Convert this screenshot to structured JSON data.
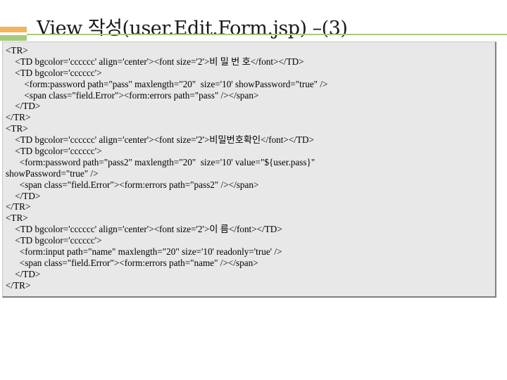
{
  "slide": {
    "title_prefix": "View ",
    "title_korean": "작성",
    "title_code": "(user.Edit.Form.jsp) –(3)"
  },
  "code_lines": [
    "<TR>",
    "    <TD bgcolor='cccccc' align='center'><font size='2'>비 밀 번 호</font></TD>",
    "    <TD bgcolor='cccccc'>",
    "        <form:password path=\"pass\" maxlength=\"20\"  size='10' showPassword=\"true\" />",
    "        <span class=\"field.Error\"><form:errors path=\"pass\" /></span>",
    "    </TD>",
    "</TR>",
    "<TR>",
    "    <TD bgcolor='cccccc' align='center'><font size='2'>비밀번호확인</font></TD>",
    "    <TD bgcolor='cccccc'>",
    "      <form:password path=\"pass2\" maxlength=\"20\"  size='10' value=\"${user.pass}\"",
    "showPassword=\"true\" />",
    "      <span class=\"field.Error\"><form:errors path=\"pass2\" /></span>",
    "    </TD>",
    "</TR>",
    "<TR>",
    "    <TD bgcolor='cccccc' align='center'><font size='2'>이 름</font></TD>",
    "    <TD bgcolor='cccccc'>",
    "      <form:input path=\"name\" maxlength=\"20\" size='10' readonly='true' />",
    "      <span class=\"field.Error\"><form:errors path=\"name\" /></span>",
    "    </TD>",
    "</TR>"
  ],
  "colors": {
    "accent_orange": "#f5b35c",
    "accent_green": "#a7c97f",
    "panel_background": "#e8e8e8"
  }
}
